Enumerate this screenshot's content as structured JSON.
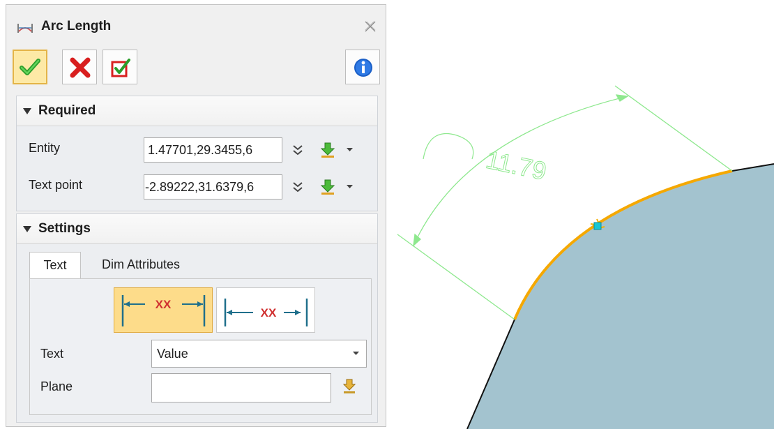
{
  "dialog": {
    "title": "Arc Length",
    "toolbar": {
      "ok": "ok",
      "cancel": "cancel",
      "apply": "apply",
      "info": "info"
    }
  },
  "required": {
    "header": "Required",
    "entity": {
      "label": "Entity",
      "value": "1.47701,29.3455,6"
    },
    "text_point": {
      "label": "Text point",
      "value": "-2.89222,31.6379,6"
    }
  },
  "settings": {
    "header": "Settings",
    "tabs": [
      "Text",
      "Dim Attributes"
    ],
    "text_style_buttons": [
      "XX",
      "XX"
    ],
    "text": {
      "label": "Text",
      "value": "Value"
    },
    "plane": {
      "label": "Plane",
      "value": ""
    }
  },
  "drawing": {
    "dimension_value": "11.79"
  },
  "colors": {
    "dimension_line": "#8ee88e",
    "arc_highlight": "#f5a800",
    "face_fill": "#a3c3cf",
    "point_marker": "#1ac6d4"
  }
}
